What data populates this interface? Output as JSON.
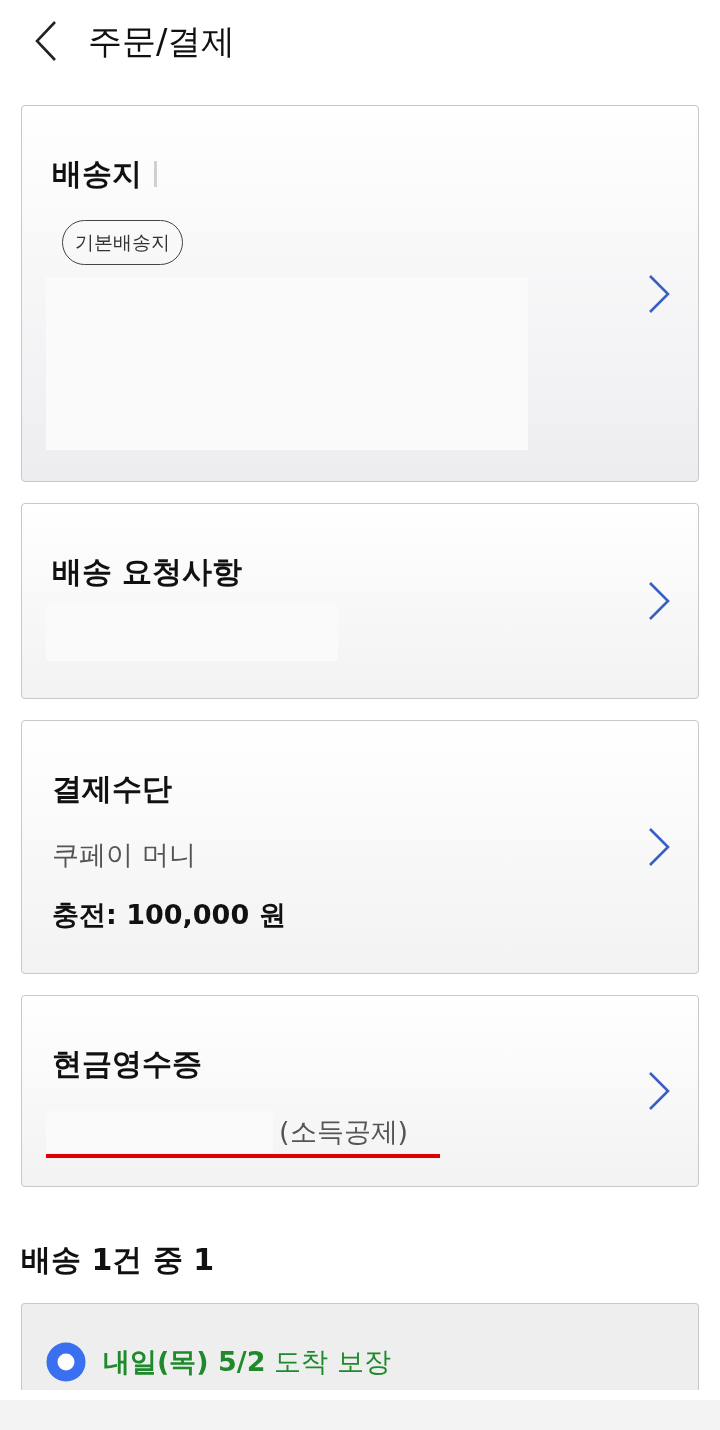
{
  "header": {
    "title": "주문/결제"
  },
  "sections": [
    {
      "kind": "address",
      "title": "배송지",
      "badge": "기본배송지"
    },
    {
      "kind": "request",
      "title": "배송 요청사항"
    },
    {
      "kind": "payment",
      "title": "결제수단",
      "method": "쿠페이 머니",
      "balance": "충전: 100,000 원"
    },
    {
      "kind": "receipt",
      "title": "현금영수증",
      "note": "(소득공제)"
    }
  ],
  "shipment": {
    "heading": "배송 1건 중 1",
    "options": [
      {
        "label": "**내일(목) 5/2** 도착 보장",
        "selected": true
      }
    ]
  }
}
